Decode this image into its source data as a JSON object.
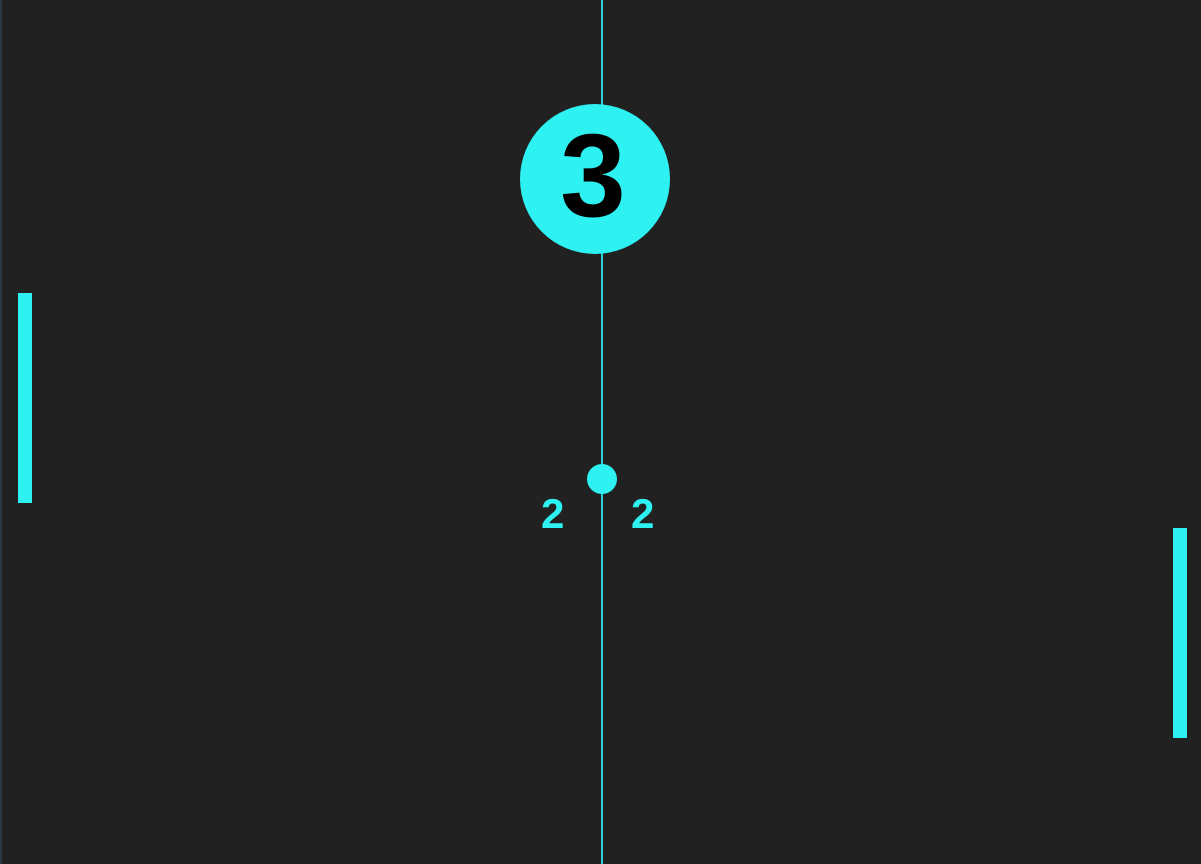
{
  "game": {
    "countdown": "3",
    "left_score": "2",
    "right_score": "2"
  },
  "colors": {
    "background": "#212121",
    "accent": "#2ef2f2",
    "countdown_text": "#000000",
    "center_line": "#2ecfd6"
  },
  "icons": {
    "ball": "ball-icon"
  }
}
